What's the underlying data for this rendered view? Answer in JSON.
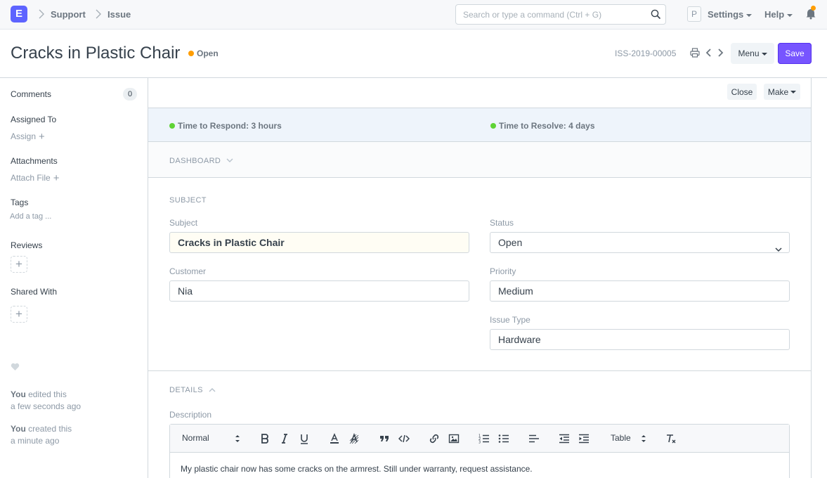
{
  "navbar": {
    "logo": "E",
    "breadcrumbs": [
      "Support",
      "Issue"
    ],
    "search_placeholder": "Search or type a command (Ctrl + G)",
    "avatar": "P",
    "settings": "Settings",
    "help": "Help"
  },
  "page": {
    "title": "Cracks in Plastic Chair",
    "status": "Open",
    "doc_name": "ISS-2019-00005",
    "menu_label": "Menu",
    "save_label": "Save"
  },
  "sidebar": {
    "comments_label": "Comments",
    "comments_count": "0",
    "assigned_to": "Assigned To",
    "assign": "Assign",
    "attachments": "Attachments",
    "attach_file": "Attach File",
    "tags": "Tags",
    "add_tag": "Add a tag ...",
    "reviews": "Reviews",
    "shared_with": "Shared With",
    "activity": [
      {
        "user": "You",
        "action": "edited this",
        "time": "a few seconds ago"
      },
      {
        "user": "You",
        "action": "created this",
        "time": "a minute ago"
      }
    ]
  },
  "toolbar": {
    "close_label": "Close",
    "make_label": "Make"
  },
  "sla": {
    "respond": "Time to Respond: 3 hours",
    "resolve": "Time to Resolve: 4 days",
    "color": "#5fd335"
  },
  "sections": {
    "dashboard": "DASHBOARD",
    "subject": "SUBJECT",
    "details": "DETAILS"
  },
  "fields": {
    "subject_label": "Subject",
    "subject_value": "Cracks in Plastic Chair",
    "status_label": "Status",
    "status_value": "Open",
    "customer_label": "Customer",
    "customer_value": "Nia",
    "priority_label": "Priority",
    "priority_value": "Medium",
    "issue_type_label": "Issue Type",
    "issue_type_value": "Hardware",
    "description_label": "Description"
  },
  "editor": {
    "format": "Normal",
    "table": "Table",
    "content": "My plastic chair now has some cracks on the armrest. Still under warranty, request assistance."
  },
  "colors": {
    "primary": "#7755ff",
    "open_status": "#ff9d00"
  }
}
